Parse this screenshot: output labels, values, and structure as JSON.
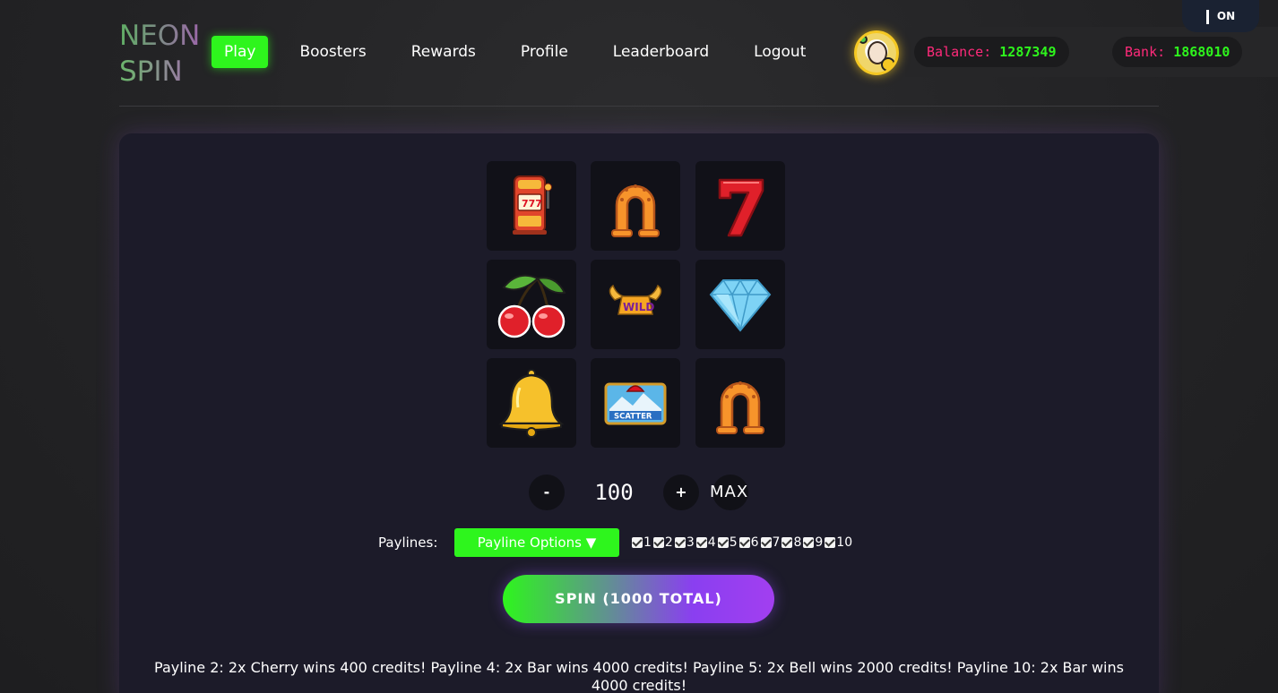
{
  "logo": {
    "line1": "NEON",
    "line2": "SPIN"
  },
  "nav": {
    "play": "Play",
    "boosters": "Boosters",
    "rewards": "Rewards",
    "profile": "Profile",
    "leaderboard": "Leaderboard",
    "logout": "Logout"
  },
  "balance": {
    "label": "Balance:",
    "value": "1287349"
  },
  "bank": {
    "label": "Bank:",
    "value": "1868010"
  },
  "toggle": {
    "label": "ON"
  },
  "reels": [
    [
      "slot-machine",
      "horseshoe",
      "seven"
    ],
    [
      "cherry",
      "wild",
      "diamond"
    ],
    [
      "bell",
      "scatter",
      "horseshoe"
    ]
  ],
  "bet": {
    "minus": "-",
    "value": "100",
    "plus": "+",
    "max": "MAX"
  },
  "paylines": {
    "label": "Paylines:",
    "options_label": "Payline Options ▼",
    "checks": [
      "1",
      "2",
      "3",
      "4",
      "5",
      "6",
      "7",
      "8",
      "9",
      "10"
    ]
  },
  "spin": {
    "label": "SPIN (1000 TOTAL)"
  },
  "result": {
    "text": "Payline 2: 2x Cherry wins 400 credits! Payline 4: 2x Bar wins 4000 credits! Payline 5: 2x Bell wins 2000 credits! Payline 10: 2x Bar wins 4000 credits!"
  },
  "colors": {
    "accent_green": "#2ef51d",
    "accent_pink": "#ff2a7a",
    "accent_purple": "#8a3ff0",
    "panel": "#1c1b29"
  }
}
